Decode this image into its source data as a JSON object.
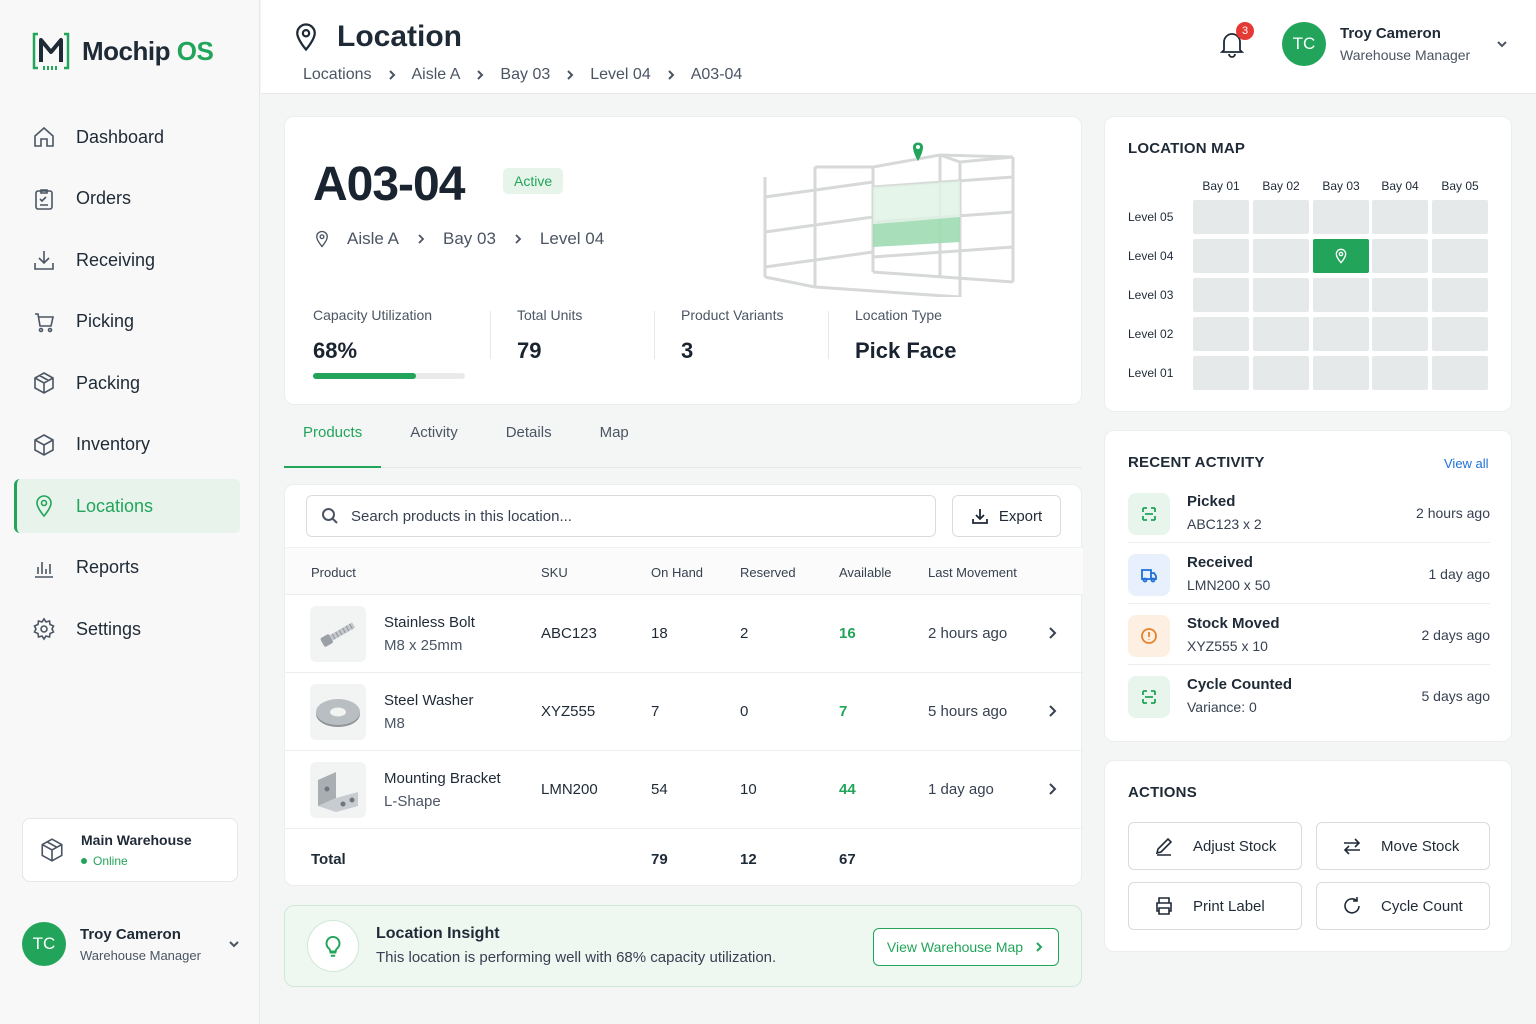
{
  "app": {
    "brand_main": "Mochip",
    "brand_accent": "OS",
    "accent_color": "#22a55a"
  },
  "sidebar": {
    "items": [
      {
        "label": "Dashboard",
        "icon": "home-icon"
      },
      {
        "label": "Orders",
        "icon": "clipboard-icon"
      },
      {
        "label": "Receiving",
        "icon": "download-icon"
      },
      {
        "label": "Picking",
        "icon": "cart-icon"
      },
      {
        "label": "Packing",
        "icon": "box-icon"
      },
      {
        "label": "Inventory",
        "icon": "cube-icon"
      },
      {
        "label": "Locations",
        "icon": "location-pin-icon",
        "active": true
      },
      {
        "label": "Reports",
        "icon": "bar-chart-icon"
      },
      {
        "label": "Settings",
        "icon": "gear-icon"
      }
    ],
    "warehouse": {
      "name": "Main Warehouse",
      "status": "Online"
    },
    "user": {
      "initials": "TC",
      "name": "Troy Cameron",
      "role": "Warehouse Manager"
    }
  },
  "header": {
    "title": "Location",
    "breadcrumb": [
      "Locations",
      "Aisle A",
      "Bay 03",
      "Level 04",
      "A03-04"
    ],
    "notifications": "3",
    "user": {
      "initials": "TC",
      "name": "Troy Cameron",
      "role": "Warehouse Manager"
    }
  },
  "location": {
    "id": "A03-04",
    "status": "Active",
    "path": [
      "Aisle A",
      "Bay 03",
      "Level 04"
    ],
    "stats": {
      "capacity_label": "Capacity Utilization",
      "capacity_value": "68%",
      "capacity_fraction": 0.68,
      "units_label": "Total Units",
      "units_value": "79",
      "variants_label": "Product Variants",
      "variants_value": "3",
      "type_label": "Location Type",
      "type_value": "Pick Face"
    }
  },
  "tabs": [
    "Products",
    "Activity",
    "Details",
    "Map"
  ],
  "products": {
    "search_placeholder": "Search products in this location...",
    "export_label": "Export",
    "columns": [
      "Product",
      "SKU",
      "On Hand",
      "Reserved",
      "Available",
      "Last Movement"
    ],
    "rows": [
      {
        "name": "Stainless Bolt",
        "sub": "M8 x 25mm",
        "sku": "ABC123",
        "on_hand": "18",
        "reserved": "2",
        "available": "16",
        "last": "2 hours ago",
        "thumb": "bolt-image"
      },
      {
        "name": "Steel Washer",
        "sub": "M8",
        "sku": "XYZ555",
        "on_hand": "7",
        "reserved": "0",
        "available": "7",
        "last": "5 hours ago",
        "thumb": "washer-image"
      },
      {
        "name": "Mounting Bracket",
        "sub": "L-Shape",
        "sku": "LMN200",
        "on_hand": "54",
        "reserved": "10",
        "available": "44",
        "last": "1 day ago",
        "thumb": "bracket-image"
      }
    ],
    "total": {
      "label": "Total",
      "on_hand": "79",
      "reserved": "12",
      "available": "67"
    }
  },
  "insight": {
    "title": "Location Insight",
    "text": "This location is performing well with 68% capacity utilization.",
    "button": "View Warehouse Map"
  },
  "location_map": {
    "title": "LOCATION MAP",
    "bays": [
      "Bay 01",
      "Bay 02",
      "Bay 03",
      "Bay 04",
      "Bay 05"
    ],
    "levels": [
      "Level 05",
      "Level 04",
      "Level 03",
      "Level 02",
      "Level 01"
    ],
    "highlight": {
      "bay": "Bay 03",
      "level": "Level 04"
    }
  },
  "recent_activity": {
    "title": "RECENT ACTIVITY",
    "view_all": "View all",
    "items": [
      {
        "title": "Picked",
        "sub": "ABC123 x 2",
        "time": "2 hours ago",
        "icon": "pick-icon",
        "color": "#22a55a"
      },
      {
        "title": "Received",
        "sub": "LMN200 x 50",
        "time": "1 day ago",
        "icon": "truck-icon",
        "color": "#1e6fd9"
      },
      {
        "title": "Stock Moved",
        "sub": "XYZ555 x 10",
        "time": "2 days ago",
        "icon": "alert-icon",
        "color": "#e8822a"
      },
      {
        "title": "Cycle Counted",
        "sub": "Variance: 0",
        "time": "5 days ago",
        "icon": "count-icon",
        "color": "#22a55a"
      }
    ]
  },
  "actions": {
    "title": "ACTIONS",
    "buttons": [
      "Adjust Stock",
      "Move Stock",
      "Print Label",
      "Cycle Count"
    ]
  }
}
